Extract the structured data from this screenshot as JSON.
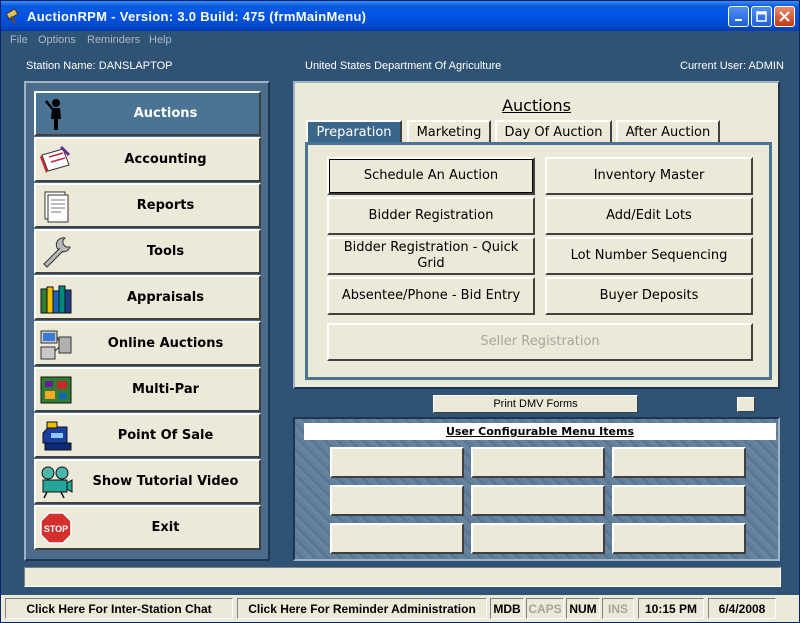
{
  "window": {
    "title": "AuctionRPM - Version: 3.0 Build: 475     (frmMainMenu)",
    "app_icon": "rpm-app-icon"
  },
  "menu": [
    "File",
    "Options",
    "Reminders",
    "Help"
  ],
  "info_bar": {
    "station": "Station Name: DANSLAPTOP",
    "organization": "United States Department Of Agriculture",
    "user": "Current User: ADMIN"
  },
  "nav": [
    {
      "label": "Auctions",
      "icon": "auctioneer-icon",
      "active": true
    },
    {
      "label": "Accounting",
      "icon": "checkbook-icon",
      "active": false
    },
    {
      "label": "Reports",
      "icon": "report-document-icon",
      "active": false
    },
    {
      "label": "Tools",
      "icon": "wrench-icon",
      "active": false
    },
    {
      "label": "Appraisals",
      "icon": "books-icon",
      "active": false
    },
    {
      "label": "Online Auctions",
      "icon": "network-computer-icon",
      "active": false
    },
    {
      "label": "Multi-Par",
      "icon": "circuit-board-icon",
      "active": false
    },
    {
      "label": "Point Of Sale",
      "icon": "cash-register-icon",
      "active": false
    },
    {
      "label": "Show Tutorial Video",
      "icon": "film-projector-icon",
      "active": false
    },
    {
      "label": "Exit",
      "icon": "stop-sign-icon",
      "active": false
    }
  ],
  "auctions_panel": {
    "title": "Auctions",
    "tabs": [
      {
        "label": "Preparation",
        "active": true
      },
      {
        "label": "Marketing",
        "active": false
      },
      {
        "label": "Day Of Auction",
        "active": false
      },
      {
        "label": "After Auction",
        "active": false
      }
    ],
    "buttons": {
      "schedule": "Schedule An Auction",
      "inventory": "Inventory Master",
      "bidder_reg": "Bidder Registration",
      "add_edit_lots": "Add/Edit Lots",
      "bidder_reg_quick": "Bidder Registration - Quick Grid",
      "lot_sequencing": "Lot Number Sequencing",
      "absentee": "Absentee/Phone - Bid Entry",
      "buyer_deposits": "Buyer Deposits",
      "seller_reg": "Seller Registration"
    }
  },
  "print_dmv": "Print DMV Forms",
  "user_menu": {
    "title": "User Configurable Menu Items"
  },
  "status_bar": {
    "chat": "Click Here For Inter-Station Chat",
    "reminder": "Click Here For Reminder Administration",
    "mdb": "MDB",
    "caps": "CAPS",
    "num": "NUM",
    "ins": "INS",
    "time": "10:15 PM",
    "date": "6/4/2008"
  }
}
